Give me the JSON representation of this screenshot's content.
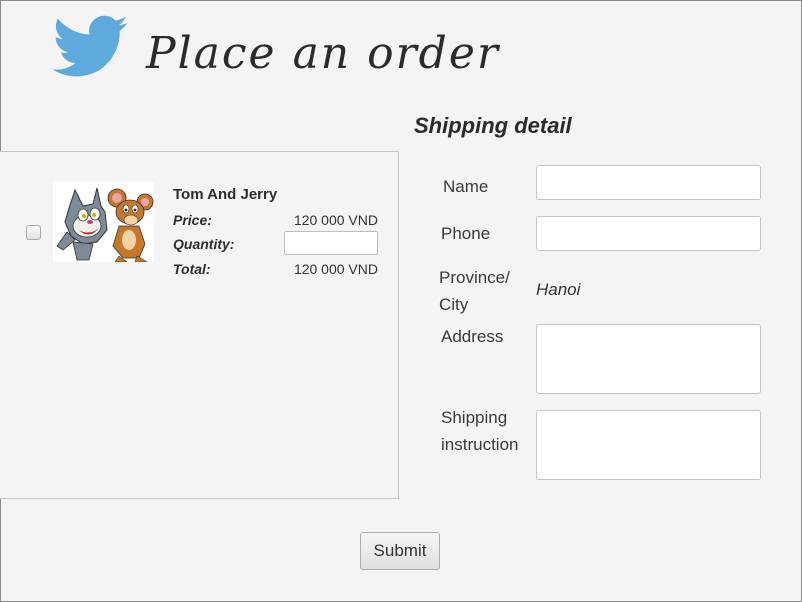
{
  "header": {
    "title": "Place an order",
    "logo_icon": "twitter-bird-icon",
    "logo_color": "#5ea9dd"
  },
  "cart": {
    "item": {
      "name": "Tom And Jerry",
      "image_icon": "tom-and-jerry-image",
      "price_label": "Price:",
      "price_value": "120 000 VND",
      "quantity_label": "Quantity:",
      "quantity_value": "",
      "total_label": "Total:",
      "total_value": "120 000 VND",
      "checked": false
    }
  },
  "shipping": {
    "title": "Shipping detail",
    "name_label": "Name",
    "name_value": "",
    "phone_label": "Phone",
    "phone_value": "",
    "province_label": "Province/ City",
    "province_value": "Hanoi",
    "address_label": "Address",
    "address_value": "",
    "instruction_label": "Shipping instruction",
    "instruction_value": ""
  },
  "actions": {
    "submit_label": "Submit"
  }
}
